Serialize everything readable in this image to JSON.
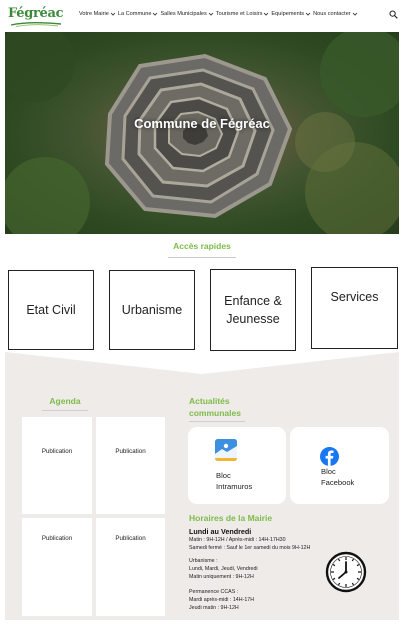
{
  "header": {
    "logo_text": "Fégréac",
    "nav": [
      {
        "label": "Votre Mairie"
      },
      {
        "label": "La Commune"
      },
      {
        "label": "Salles Municipales"
      },
      {
        "label": "Tourisme et Loisirs"
      },
      {
        "label": "Equipements"
      },
      {
        "label": "Nous contacter"
      }
    ]
  },
  "hero": {
    "title": "Commune de Fégréac"
  },
  "quick_access": {
    "title": "Accès rapides",
    "items": [
      {
        "line1": "Etat Civil",
        "line2": ""
      },
      {
        "line1": "Urbanisme",
        "line2": ""
      },
      {
        "line1": "Enfance &",
        "line2": "Jeunesse"
      },
      {
        "line1": "Services",
        "line2": ""
      }
    ]
  },
  "agenda": {
    "title": "Agenda",
    "items": [
      "Publication",
      "Publication",
      "Publication",
      "Publication"
    ]
  },
  "actualites": {
    "title_line1": "Actualités",
    "title_line2": "communales",
    "intramuros": {
      "line1": "Bloc",
      "line2": "Intramuros"
    },
    "facebook": {
      "line1": "Bloc",
      "line2": "Facebook"
    }
  },
  "horaires": {
    "title": "Horaires de la Mairie",
    "days": "Lundi au Vendredi",
    "line1": "Matin : 9H-12H / Après-midi : 14H-17H30",
    "line2": "Samedi fermé : Sauf le 1er samedi du mois 9H-12H",
    "urb_title": "Urbanisme :",
    "urb_days": "Lundi, Mardi, Jeudi, Vendredi",
    "urb_hours": "Matin uniquement : 9H-12H",
    "ccas_title": "Permanence CCAS :",
    "ccas_line1": "Mardi après-midi : 14H-17H",
    "ccas_line2": "Jeudi matin : 9H-12H"
  },
  "colors": {
    "accent_green": "#7dbb4a",
    "band_background": "#efebe8",
    "facebook_blue": "#1877f2",
    "intramuros_blue": "#3d8fe0"
  },
  "icons": [
    "chevron-down-icon",
    "search-icon",
    "intramuros-icon",
    "facebook-icon",
    "clock-icon"
  ]
}
